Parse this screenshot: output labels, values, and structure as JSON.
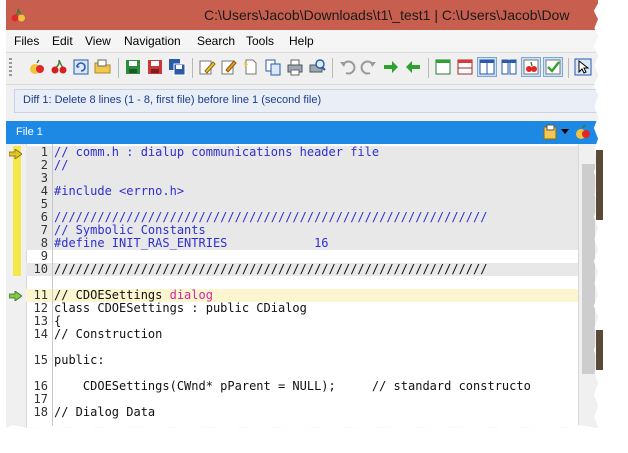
{
  "window": {
    "title": "C:\\Users\\Jacob\\Downloads\\t1\\_test1  |  C:\\Users\\Jacob\\Dow"
  },
  "menu": [
    "Files",
    "Edit",
    "View",
    "Navigation",
    "Search",
    "Tools",
    "Help"
  ],
  "diff_status": "Diff 1: Delete 8 lines (1 - 8, first file) before line 1 (second file)",
  "file_pane": {
    "label": "File 1"
  },
  "code_lines": [
    {
      "num": "1",
      "text": "// comm.h : dialup communications header file"
    },
    {
      "num": "2",
      "text": "//"
    },
    {
      "num": "3",
      "text": ""
    },
    {
      "num": "4",
      "text": "#include <errno.h>"
    },
    {
      "num": "5",
      "text": ""
    },
    {
      "num": "6",
      "text": "////////////////////////////////////////////////////////////"
    },
    {
      "num": "7",
      "text": "// Symbolic Constants"
    },
    {
      "num": "8",
      "text": "#define INIT_RAS_ENTRIES            16"
    },
    {
      "num": "9",
      "text": ""
    },
    {
      "num": "10",
      "text": "////////////////////////////////////////////////////////////"
    },
    {
      "num": "11",
      "text": "// CDOESettings",
      "text_extra": " dialog"
    },
    {
      "num": "12",
      "text": "class CDOESettings : public CDialog"
    },
    {
      "num": "13",
      "text": "{"
    },
    {
      "num": "14",
      "text": "// Construction"
    },
    {
      "num": "15",
      "text": "public:"
    },
    {
      "num": "16",
      "text": "    CDOESettings(CWnd* pParent = NULL);     // standard constructo"
    },
    {
      "num": "17",
      "text": ""
    },
    {
      "num": "18",
      "text": "// Dialog Data"
    }
  ],
  "colors": {
    "titlebar": "#c85f4e",
    "file_header": "#1e88e5",
    "comment": "#2f2fd0",
    "keyword_highlight": "#d3289c",
    "removed_line_bg": "#e8e8e8",
    "current_line_bg": "#fbf5d0",
    "gutter_marker": "#f7e84a"
  }
}
